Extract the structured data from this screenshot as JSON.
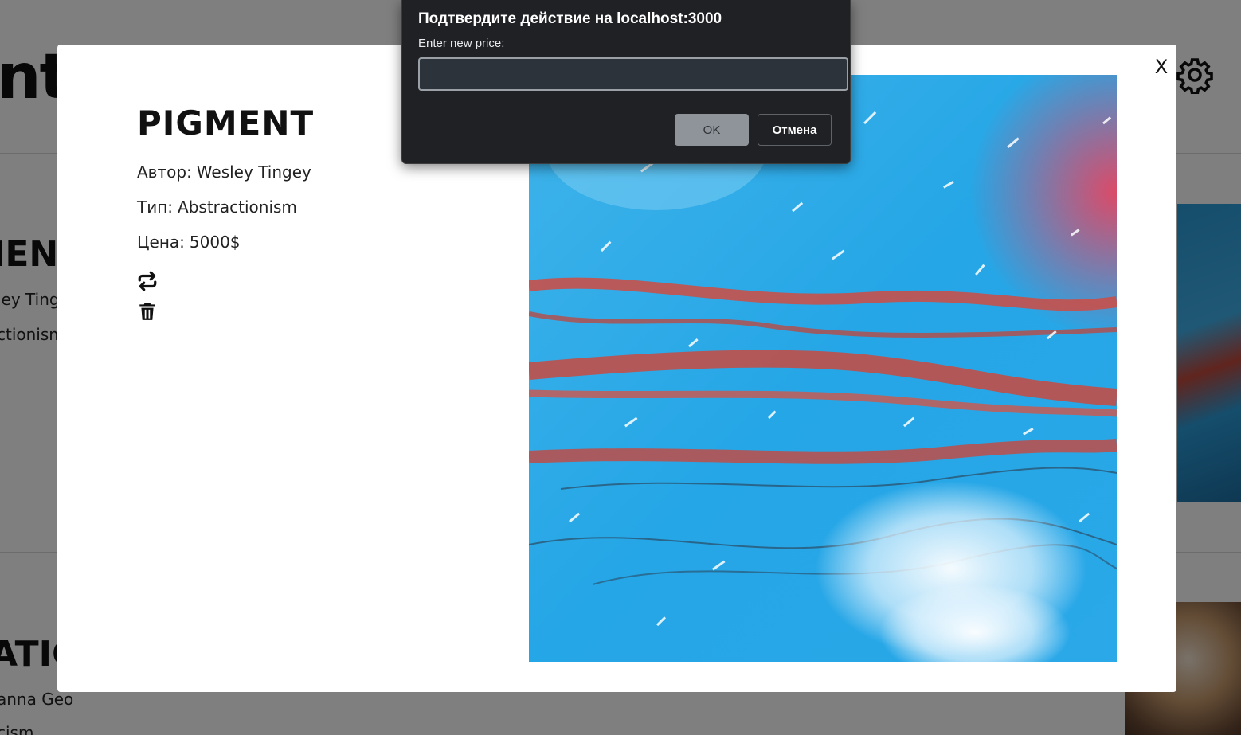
{
  "background": {
    "logo_fragment": "nt",
    "cards": [
      {
        "title_fragment": "IEN",
        "author_fragment": "ley Ting",
        "type_fragment": "ctionism"
      },
      {
        "title_fragment": "ATIC",
        "author_fragment": "anna Geo",
        "type_fragment": "cism"
      }
    ]
  },
  "header": {
    "settings_icon": "gear-icon"
  },
  "modal": {
    "close_label": "X",
    "title": "PIGMENT",
    "author_label": "Автор:",
    "author": "Wesley Tingey",
    "type_label": "Тип:",
    "type": "Abstractionism",
    "price_label": "Цена:",
    "price": "5000$",
    "actions": [
      {
        "icon": "repeat-icon"
      },
      {
        "icon": "trash-icon"
      }
    ]
  },
  "dialog": {
    "title": "Подтвердите действие на localhost:3000",
    "message": "Enter new price:",
    "input_value": "",
    "ok_label": "OK",
    "cancel_label": "Отмена"
  }
}
